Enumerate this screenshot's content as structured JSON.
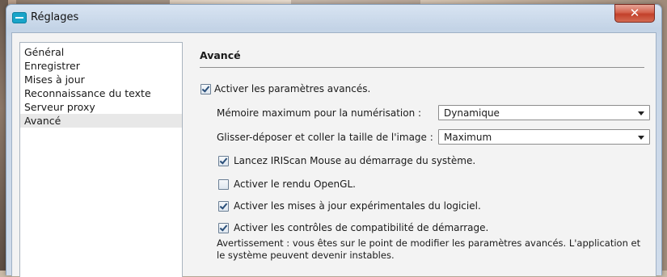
{
  "window": {
    "title": "Réglages",
    "close_glyph": "✕"
  },
  "sidebar": {
    "items": [
      {
        "label": "Général",
        "selected": false
      },
      {
        "label": "Enregistrer",
        "selected": false
      },
      {
        "label": "Mises à jour",
        "selected": false
      },
      {
        "label": "Reconnaissance du texte",
        "selected": false
      },
      {
        "label": "Serveur proxy",
        "selected": false
      },
      {
        "label": "Avancé",
        "selected": true
      }
    ]
  },
  "panel": {
    "heading": "Avancé",
    "enable_advanced": {
      "label": "Activer les paramètres avancés.",
      "checked": true
    },
    "max_memory": {
      "label": "Mémoire maximum pour la numérisation :",
      "value": "Dynamique"
    },
    "drag_drop_size": {
      "label": "Glisser-déposer et coller la taille de l'image :",
      "value": "Maximum"
    },
    "options": [
      {
        "label": "Lancez IRIScan Mouse au démarrage du système.",
        "checked": true
      },
      {
        "label": "Activer le rendu OpenGL.",
        "checked": false
      },
      {
        "label": "Activer les mises à jour expérimentales du logiciel.",
        "checked": true
      },
      {
        "label": "Activer les contrôles de compatibilité de démarrage.",
        "checked": true
      }
    ],
    "warning": "Avertissement : vous êtes sur le point de modifier les paramètres avancés. L'application et le système peuvent devenir instables."
  },
  "colors": {
    "titlebar": "#c3d3e6",
    "close_button": "#c2402a",
    "app_icon": "#19a4c9",
    "selected_item": "#e8e8e8"
  },
  "icons": {
    "app": "app-icon",
    "close": "close-icon",
    "dropdown": "chevron-down-icon",
    "checkbox": "checkbox-icon"
  }
}
